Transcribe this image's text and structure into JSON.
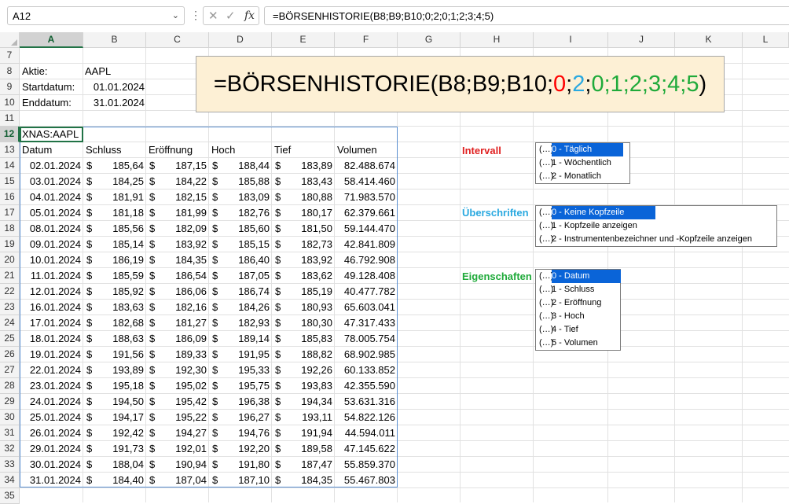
{
  "formula_bar": {
    "name_box": "A12",
    "formula": "=BÖRSENHISTORIE(B8;B9;B10;0;2;0;1;2;3;4;5)"
  },
  "columns": [
    "A",
    "B",
    "C",
    "D",
    "E",
    "F",
    "G",
    "H",
    "I",
    "J",
    "K",
    "L"
  ],
  "rows": [
    "7",
    "8",
    "9",
    "10",
    "11",
    "12",
    "13",
    "14",
    "15",
    "16",
    "17",
    "18",
    "19",
    "20",
    "21",
    "22",
    "23",
    "24",
    "25",
    "26",
    "27",
    "28",
    "29",
    "30",
    "31",
    "32",
    "33",
    "34",
    "35"
  ],
  "inputs": {
    "aktie_label": "Aktie:",
    "aktie_value": "AAPL",
    "start_label": "Startdatum:",
    "start_value": "01.01.2024",
    "end_label": "Enddatum:",
    "end_value": "31.01.2024"
  },
  "table": {
    "instrument": "XNAS:AAPL",
    "headers": [
      "Datum",
      "Schluss",
      "Eröffnung",
      "Hoch",
      "Tief",
      "Volumen"
    ],
    "currency": "$",
    "rows": [
      [
        "02.01.2024",
        "185,64",
        "187,15",
        "188,44",
        "183,89",
        "82.488.674"
      ],
      [
        "03.01.2024",
        "184,25",
        "184,22",
        "185,88",
        "183,43",
        "58.414.460"
      ],
      [
        "04.01.2024",
        "181,91",
        "182,15",
        "183,09",
        "180,88",
        "71.983.570"
      ],
      [
        "05.01.2024",
        "181,18",
        "181,99",
        "182,76",
        "180,17",
        "62.379.661"
      ],
      [
        "08.01.2024",
        "185,56",
        "182,09",
        "185,60",
        "181,50",
        "59.144.470"
      ],
      [
        "09.01.2024",
        "185,14",
        "183,92",
        "185,15",
        "182,73",
        "42.841.809"
      ],
      [
        "10.01.2024",
        "186,19",
        "184,35",
        "186,40",
        "183,92",
        "46.792.908"
      ],
      [
        "11.01.2024",
        "185,59",
        "186,54",
        "187,05",
        "183,62",
        "49.128.408"
      ],
      [
        "12.01.2024",
        "185,92",
        "186,06",
        "186,74",
        "185,19",
        "40.477.782"
      ],
      [
        "16.01.2024",
        "183,63",
        "182,16",
        "184,26",
        "180,93",
        "65.603.041"
      ],
      [
        "17.01.2024",
        "182,68",
        "181,27",
        "182,93",
        "180,30",
        "47.317.433"
      ],
      [
        "18.01.2024",
        "188,63",
        "186,09",
        "189,14",
        "185,83",
        "78.005.754"
      ],
      [
        "19.01.2024",
        "191,56",
        "189,33",
        "191,95",
        "188,82",
        "68.902.985"
      ],
      [
        "22.01.2024",
        "193,89",
        "192,30",
        "195,33",
        "192,26",
        "60.133.852"
      ],
      [
        "23.01.2024",
        "195,18",
        "195,02",
        "195,75",
        "193,83",
        "42.355.590"
      ],
      [
        "24.01.2024",
        "194,50",
        "195,42",
        "196,38",
        "194,34",
        "53.631.316"
      ],
      [
        "25.01.2024",
        "194,17",
        "195,22",
        "196,27",
        "193,11",
        "54.822.126"
      ],
      [
        "26.01.2024",
        "192,42",
        "194,27",
        "194,76",
        "191,94",
        "44.594.011"
      ],
      [
        "29.01.2024",
        "191,73",
        "192,01",
        "192,20",
        "189,58",
        "47.145.622"
      ],
      [
        "30.01.2024",
        "188,04",
        "190,94",
        "191,80",
        "187,47",
        "55.859.370"
      ],
      [
        "31.01.2024",
        "184,40",
        "187,04",
        "187,10",
        "184,35",
        "55.467.803"
      ]
    ]
  },
  "banner": {
    "prefix": "=BÖRSENHISTORIE(B8;B9;B10;",
    "p_red": "0",
    "sep1": ";",
    "p_blue": "2",
    "sep2": ";",
    "p_green": "0;1;2;3;4;5",
    "suffix": ")",
    "colors": {
      "red": "#ff0000",
      "blue": "#2aa9e0",
      "green": "#1faa3a"
    }
  },
  "params": {
    "intervall": {
      "label": "Intervall",
      "color": "#e02020",
      "options": [
        "0 - Täglich",
        "1 - Wöchentlich",
        "2 - Monatlich"
      ]
    },
    "ueberschriften": {
      "label": "Überschriften",
      "color": "#2aa9e0",
      "options": [
        "0 - Keine Kopfzeile",
        "1 - Kopfzeile anzeigen",
        "2 - Instrumentenbezeichner und -Kopfzeile anzeigen"
      ]
    },
    "eigenschaften": {
      "label": "Eigenschaften",
      "color": "#1faa3a",
      "options": [
        "0 - Datum",
        "1 - Schluss",
        "2 - Eröffnung",
        "3 - Hoch",
        "4 - Tief",
        "5 - Volumen"
      ]
    }
  },
  "option_icon": "(…)",
  "accent": "#217346",
  "highlight": "#0a64d8"
}
